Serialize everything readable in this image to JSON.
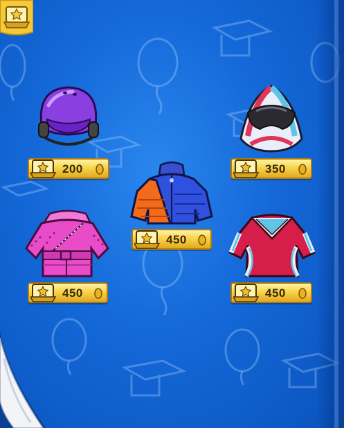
{
  "catalog": {
    "items": [
      {
        "name": "Purple Helmet",
        "price": "200"
      },
      {
        "name": "Pink and Blue Ski Mask",
        "price": "350"
      },
      {
        "name": "Orange and Blue Puffer Jacket",
        "price": "450"
      },
      {
        "name": "Pink Snowsuit",
        "price": "450"
      },
      {
        "name": "Red and Blue Ski Suit",
        "price": "450"
      }
    ]
  },
  "colors": {
    "background": "#1468d8",
    "price_tag": "#f7d44c",
    "coin": "#e8b324"
  },
  "icons": {
    "corner": "member-star-badge-icon",
    "price_badge": "member-badge-icon",
    "currency": "coin-icon"
  }
}
